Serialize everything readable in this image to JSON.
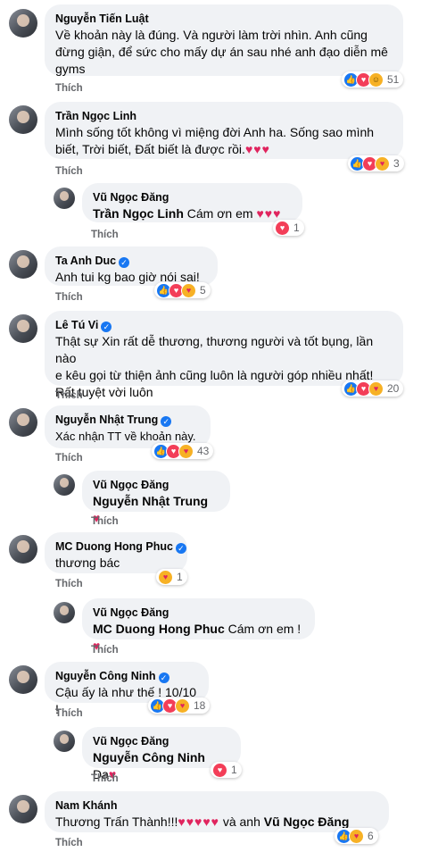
{
  "like_label": "Thích",
  "comments": [
    {
      "author": "Nguyễn Tiến Luật",
      "verified": false,
      "lines": [
        "Về khoản này là đúng. Và người làm trời nhìn. Anh cũng",
        "đừng giận, để sức cho mấy dự án sau nhé anh đạo diễn mê",
        "gyms"
      ],
      "reactions": [
        "like",
        "love",
        "haha"
      ],
      "count": "51"
    },
    {
      "author": "Trần Ngọc Linh",
      "verified": false,
      "lines": [
        "Mình sống tốt không vì miệng đời Anh ha. Sống sao mình",
        "biết, Trời biết, Đất biết là được rồi."
      ],
      "hearts": "♥♥♥",
      "reactions": [
        "like",
        "love",
        "care"
      ],
      "count": "3"
    },
    {
      "author": "Vũ Ngọc Đăng",
      "verified": false,
      "reply": true,
      "tag": "Trần Ngọc Linh",
      "text": "Cám ơn em",
      "hearts": "♥♥♥",
      "reactions": [
        "love"
      ],
      "count": "1"
    },
    {
      "author": "Ta Anh Duc",
      "verified": true,
      "lines": [
        "Anh tui kg bao giờ nói sai!"
      ],
      "reactions": [
        "like",
        "love",
        "care"
      ],
      "count": "5"
    },
    {
      "author": "Lê Tú Vi",
      "verified": true,
      "lines": [
        "Thật sự Xin rất dễ thương, thương người và tốt bụng, lần nào",
        "e kêu gọi từ thiện ảnh cũng luôn là người góp nhiều nhất!",
        "Rất tuyệt vời luôn"
      ],
      "reactions": [
        "like",
        "love",
        "care"
      ],
      "count": "20"
    },
    {
      "author": "Nguyễn Nhật Trung",
      "verified": true,
      "lines": [
        "Xác nhận TT về khoản này."
      ],
      "reactions": [
        "like",
        "love",
        "care"
      ],
      "count": "43"
    },
    {
      "author": "Vũ Ngọc Đăng",
      "verified": false,
      "reply": true,
      "tag": "Nguyễn Nhật Trung",
      "text": "",
      "hearts": "♥",
      "reactions": [],
      "count": ""
    },
    {
      "author": "MC Duong Hong Phuc",
      "verified": true,
      "lines": [
        "thương bác"
      ],
      "reactions": [
        "care"
      ],
      "count": "1"
    },
    {
      "author": "Vũ Ngọc Đăng",
      "verified": false,
      "reply": true,
      "tag": "MC Duong Hong Phuc",
      "text": "Cám ơn em !",
      "hearts": "♥",
      "reactions": [],
      "count": ""
    },
    {
      "author": "Nguyễn Công Ninh",
      "verified": true,
      "lines": [
        "Cậu ấy là như thế ! 10/10 !"
      ],
      "reactions": [
        "like",
        "love",
        "care"
      ],
      "count": "18"
    },
    {
      "author": "Vũ Ngọc Đăng",
      "verified": false,
      "reply": true,
      "tag": "Nguyễn Công Ninh",
      "text": "Dạ",
      "hearts": "♥",
      "reactions": [
        "love"
      ],
      "count": "1"
    },
    {
      "author": "Nam Khánh",
      "verified": false,
      "lines": [
        "Thương Trấn Thành!!!"
      ],
      "hearts": "♥♥♥♥♥",
      "suffix": " và anh ",
      "suffix_tag": "Vũ Ngọc Đăng",
      "reactions": [
        "like",
        "care"
      ],
      "count": "6"
    }
  ]
}
